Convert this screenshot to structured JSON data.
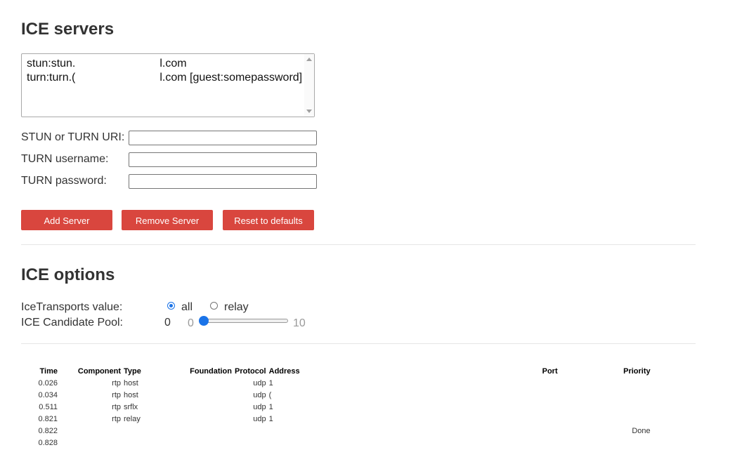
{
  "ice_servers": {
    "heading": "ICE servers",
    "list": [
      {
        "prefix": "stun:stun.",
        "suffix": "l.com"
      },
      {
        "prefix": "turn:turn.(",
        "suffix": "l.com [guest:somepassword]"
      }
    ],
    "fields": {
      "uri_label": "STUN or TURN URI:",
      "username_label": "TURN username:",
      "password_label": "TURN password:"
    },
    "buttons": {
      "add": "Add Server",
      "remove": "Remove Server",
      "reset": "Reset to defaults"
    }
  },
  "ice_options": {
    "heading": "ICE options",
    "transports_label": "IceTransports value:",
    "transports_options": [
      "all",
      "relay"
    ],
    "transports_selected": "all",
    "pool_label": "ICE Candidate Pool:",
    "pool_value": "0",
    "pool_min": "0",
    "pool_max": "10",
    "pool_level_fraction": 0
  },
  "candidates": {
    "headers": {
      "time": "Time",
      "component": "Component",
      "type": "Type",
      "foundation": "Foundation",
      "protocol": "Protocol",
      "address": "Address",
      "port": "Port",
      "priority": "Priority"
    },
    "rows": [
      {
        "time": "0.026",
        "component": "rtp",
        "type": "host",
        "protocol": "udp",
        "address": "1",
        "priority": ""
      },
      {
        "time": "0.034",
        "component": "rtp",
        "type": "host",
        "protocol": "udp",
        "address": "(",
        "priority": ""
      },
      {
        "time": "0.511",
        "component": "rtp",
        "type": "srflx",
        "protocol": "udp",
        "address": "1",
        "priority": ""
      },
      {
        "time": "0.821",
        "component": "rtp",
        "type": "relay",
        "protocol": "udp",
        "address": "1",
        "priority": ""
      },
      {
        "time": "0.822",
        "component": "",
        "type": "",
        "protocol": "",
        "address": "",
        "priority": "Done"
      },
      {
        "time": "0.828",
        "component": "",
        "type": "",
        "protocol": "",
        "address": "",
        "priority": ""
      }
    ]
  },
  "colors": {
    "button": "#d9463e",
    "accent": "#1a73e8"
  }
}
